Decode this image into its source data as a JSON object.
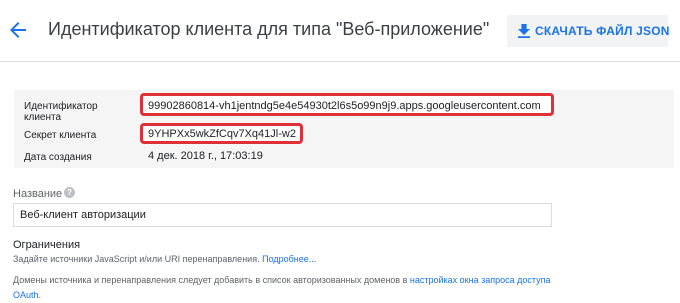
{
  "header": {
    "title": "Идентификатор клиента для типа \"Веб-приложение\"",
    "download_label": "СКАЧАТЬ ФАЙЛ JSON"
  },
  "details": {
    "client_id_label": "Идентификатор клиента",
    "client_id_value": "99902860814-vh1jentndg5e4e54930t2l6s5o99n9j9.apps.googleusercontent.com",
    "client_secret_label": "Секрет клиента",
    "client_secret_value": "9YHPXx5wkZfCqv7Xq41Jl-w2",
    "created_label": "Дата создания",
    "created_value": "4 дек. 2018 г., 17:03:19"
  },
  "form": {
    "name_label": "Название",
    "name_value": "Веб-клиент авторизации",
    "help_glyph": "?"
  },
  "restrictions": {
    "title": "Ограничения",
    "hint": "Задайте источники JavaScript и/или URI перенаправления.",
    "hint_link": "Подробнее...",
    "note_prefix": "Домены источника и перенаправления следует добавить в список авторизованных доменов в",
    "note_link": "настройках окна запроса доступа OAuth",
    "note_suffix": "."
  },
  "colors": {
    "accent": "#1a73e8",
    "highlight": "#e03037",
    "details_bg": "#f5f5f5"
  },
  "icons": {
    "back": "arrow-back-icon",
    "download": "download-icon",
    "help": "help-icon"
  }
}
